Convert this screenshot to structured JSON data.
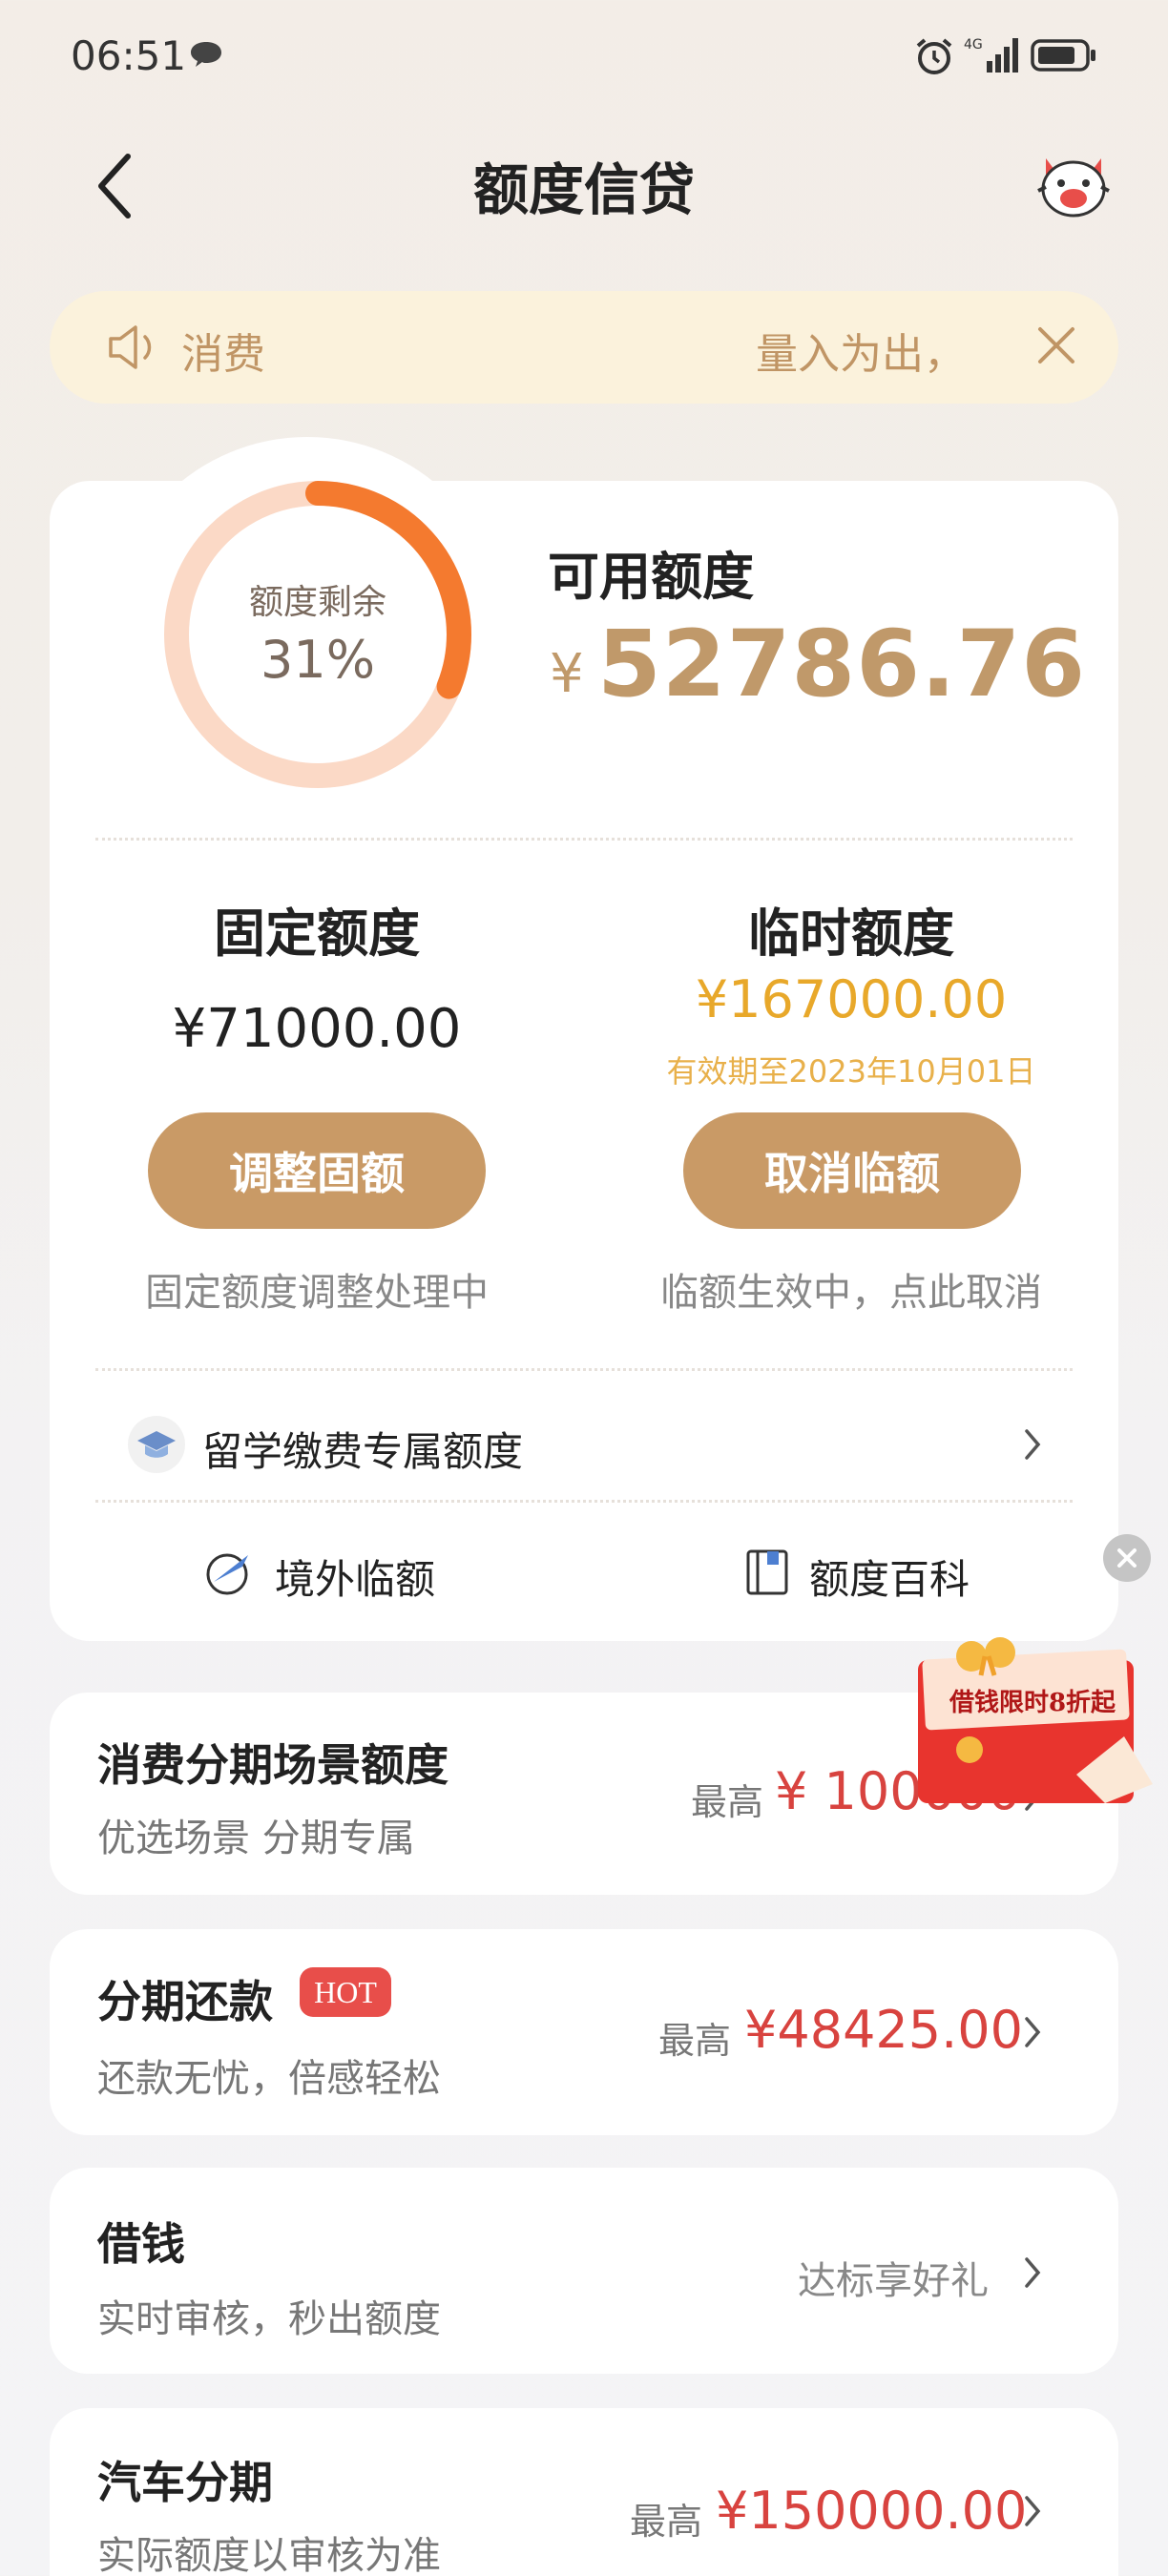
{
  "status_bar": {
    "time": "06:51",
    "network": "4G"
  },
  "header": {
    "title": "额度信贷"
  },
  "notice": {
    "left_text": "消费",
    "right_text": "量入为出，"
  },
  "credit": {
    "ring_label": "额度剩余",
    "ring_percent_text": "31%",
    "ring_percent_value": 0.31,
    "available_label": "可用额度",
    "currency_symbol": "¥",
    "available_amount": "52786.76",
    "fixed": {
      "title": "固定额度",
      "amount": "¥71000.00",
      "button": "调整固额",
      "note": "固定额度调整处理中"
    },
    "temp": {
      "title": "临时额度",
      "amount": "¥167000.00",
      "valid": "有效期至2023年10月01日",
      "button": "取消临额",
      "note": "临额生效中，点此取消"
    },
    "study_item": "留学缴费专属额度",
    "links": {
      "overseas": "境外临额",
      "wiki": "额度百科"
    }
  },
  "promo": {
    "text": "借钱限时8折起"
  },
  "list": [
    {
      "title": "消费分期场景额度",
      "sub": "优选场景 分期专属",
      "pre": "最高",
      "amount": "¥ 100000"
    },
    {
      "title": "分期还款",
      "badge": "HOT",
      "sub": "还款无忧，倍感轻松",
      "pre": "最高",
      "amount": "¥48425.00"
    },
    {
      "title": "借钱",
      "sub": "实时审核，秒出额度",
      "right_text": "达标享好礼"
    },
    {
      "title": "汽车分期",
      "sub": "实际额度以审核为准",
      "pre": "最高",
      "amount": "¥150000.00"
    }
  ],
  "colors": {
    "accent": "#c99a66",
    "ring": "#f47a2f",
    "ring_track": "#fbd9c6",
    "red": "#d8433f",
    "gold": "#e8a82a"
  }
}
